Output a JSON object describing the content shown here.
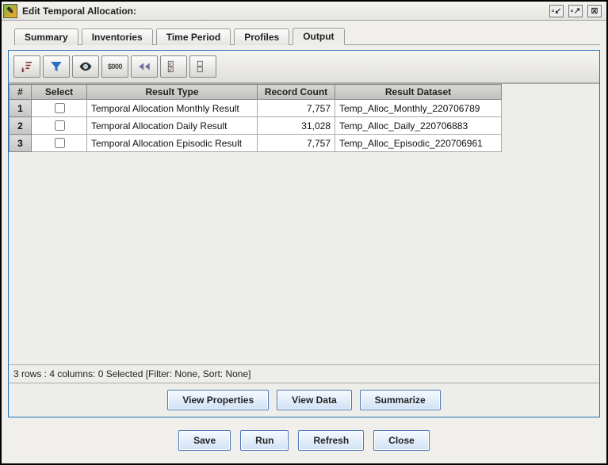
{
  "window": {
    "title": "Edit Temporal Allocation:"
  },
  "tabs": {
    "summary": "Summary",
    "inventories": "Inventories",
    "timeperiod": "Time Period",
    "profiles": "Profiles",
    "output": "Output",
    "active_index": 4
  },
  "table": {
    "headers": {
      "rownum": "#",
      "select": "Select",
      "type": "Result Type",
      "count": "Record Count",
      "dataset": "Result Dataset"
    },
    "rows": [
      {
        "n": "1",
        "selected": false,
        "type": "Temporal Allocation Monthly Result",
        "count": "7,757",
        "dataset": "Temp_Alloc_Monthly_220706789"
      },
      {
        "n": "2",
        "selected": false,
        "type": "Temporal Allocation Daily Result",
        "count": "31,028",
        "dataset": "Temp_Alloc_Daily_220706883"
      },
      {
        "n": "3",
        "selected": false,
        "type": "Temporal Allocation Episodic Result",
        "count": "7,757",
        "dataset": "Temp_Alloc_Episodic_220706961"
      }
    ]
  },
  "status": "3 rows : 4 columns: 0 Selected [Filter: None, Sort: None]",
  "actions": {
    "view_properties": "View Properties",
    "view_data": "View Data",
    "summarize": "Summarize"
  },
  "footer": {
    "save": "Save",
    "run": "Run",
    "refresh": "Refresh",
    "close": "Close"
  },
  "toolbar_icons": {
    "money_text": "$000"
  }
}
